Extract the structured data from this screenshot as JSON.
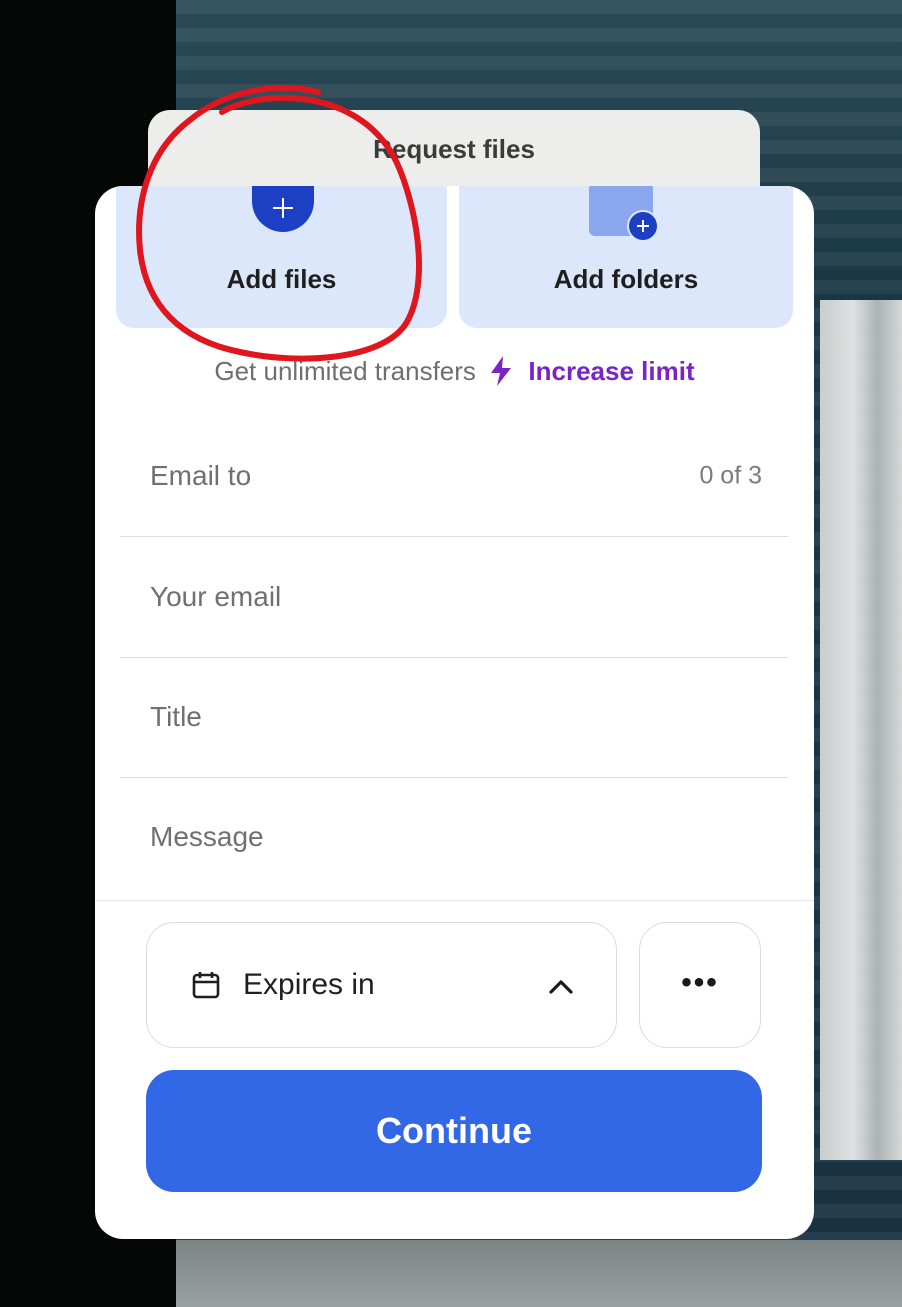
{
  "header": {
    "tab_label": "Request files"
  },
  "upload": {
    "add_files_label": "Add files",
    "add_folders_label": "Add folders"
  },
  "limit": {
    "prompt_text": "Get unlimited transfers",
    "link_label": "Increase limit",
    "bolt_icon": "bolt-icon",
    "link_color": "#7a24c8"
  },
  "form": {
    "email_to": {
      "label": "Email to",
      "count": "0 of 3"
    },
    "your_email": {
      "label": "Your email"
    },
    "title": {
      "label": "Title"
    },
    "message": {
      "label": "Message"
    }
  },
  "options": {
    "expires_label": "Expires in",
    "calendar_icon": "calendar-icon",
    "chevron_icon": "chevron-up-icon",
    "more_label": "•••"
  },
  "actions": {
    "continue_label": "Continue",
    "continue_color": "#3268e6"
  },
  "annotation": {
    "type": "red hand-drawn circle around Add files",
    "color": "#e0161f"
  }
}
